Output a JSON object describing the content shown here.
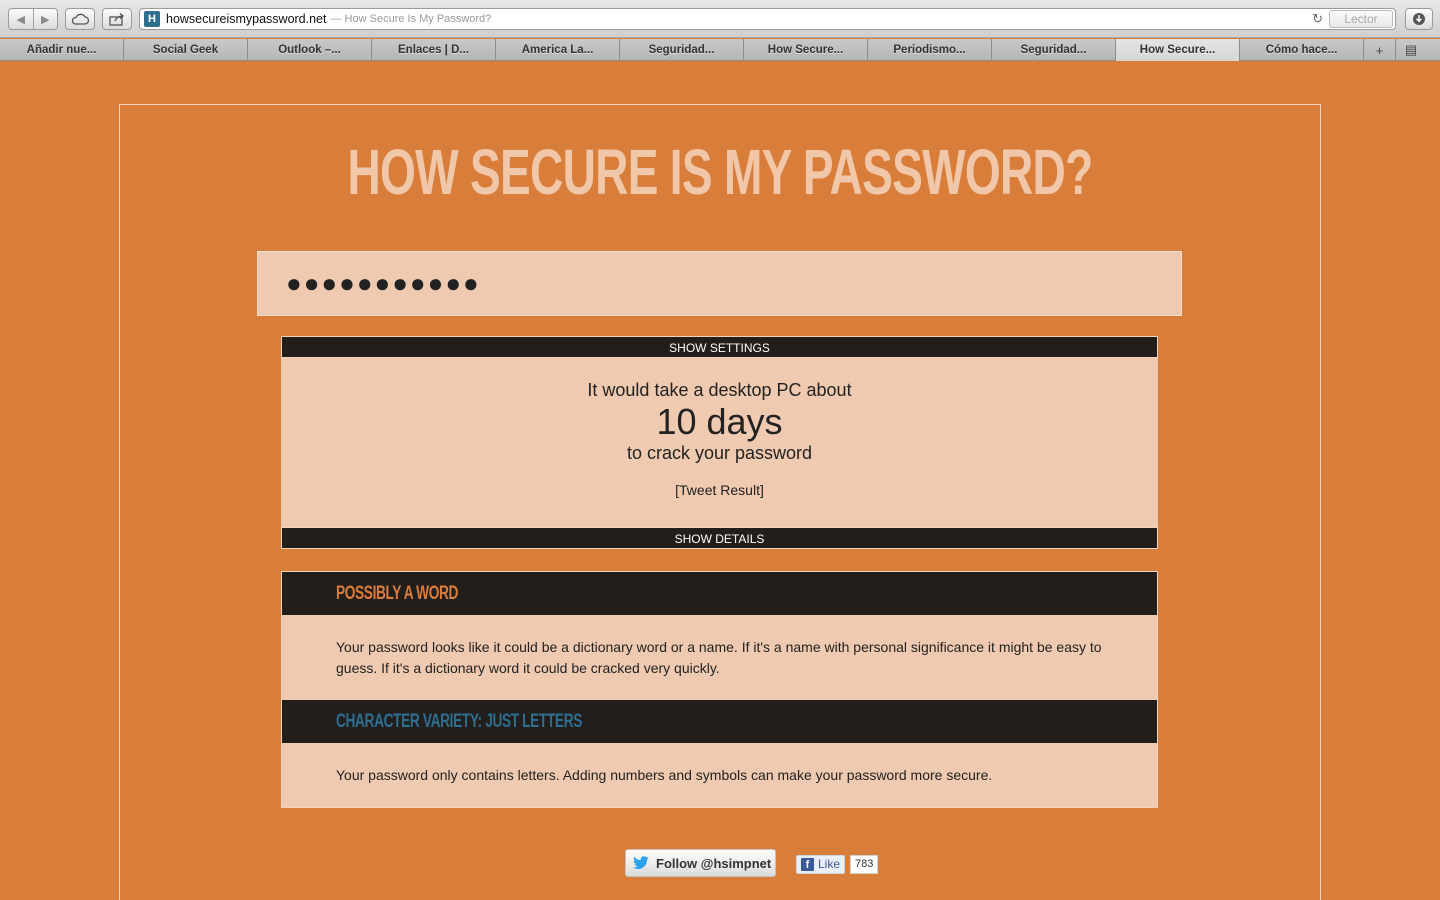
{
  "browser": {
    "url": "howsecureismypassword.net",
    "page_title": "— How Secure Is My Password?",
    "reader_label": "Lector",
    "favicon_letter": "H",
    "tabs": [
      {
        "label": "Añadir nue..."
      },
      {
        "label": "Social Geek"
      },
      {
        "label": "Outlook –..."
      },
      {
        "label": "Enlaces | D..."
      },
      {
        "label": "America La..."
      },
      {
        "label": "Seguridad..."
      },
      {
        "label": "How Secure..."
      },
      {
        "label": "Periodismo..."
      },
      {
        "label": "Seguridad..."
      },
      {
        "label": "How Secure..."
      },
      {
        "label": "Cómo hace..."
      }
    ],
    "active_tab_index": 9
  },
  "page": {
    "heading": "HOW SECURE IS MY PASSWORD?",
    "password_masked": "●●●●●●●●●●●",
    "show_settings_label": "SHOW SETTINGS",
    "result": {
      "line1": "It would take a desktop PC about",
      "time": "10 days",
      "line3": "to crack your password",
      "tweet_link": "[Tweet Result]"
    },
    "show_details_label": "SHOW DETAILS",
    "details": [
      {
        "heading": "POSSIBLY A WORD",
        "heading_color": "#d97d3a",
        "text": "Your password looks like it could be a dictionary word or a name. If it's a name with personal significance it might be easy to guess. If it's a dictionary word it could be cracked very quickly."
      },
      {
        "heading": "CHARACTER VARIETY: JUST LETTERS",
        "heading_color": "#2e6e8e",
        "text": "Your password only contains letters. Adding numbers and symbols can make your password more secure."
      }
    ],
    "social": {
      "follow_label": "Follow @hsimpnet",
      "like_label": "Like",
      "like_count": "783"
    }
  },
  "colors": {
    "background": "#d97d3a",
    "panel": "#efc9b0",
    "dark_bar": "#221e1b",
    "heading_text": "#f0c7a8"
  }
}
